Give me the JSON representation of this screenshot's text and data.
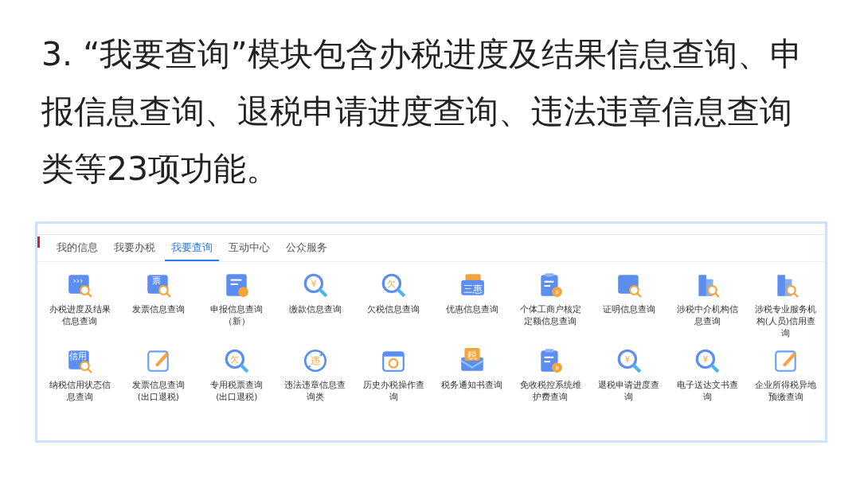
{
  "heading": "3. “我要查询”模块包含办税进度及结果信息查询、申报信息查询、退税申请进度查询、违法违章信息查询类等23项功能。",
  "tabs": [
    {
      "label": "我的信息",
      "selected": false
    },
    {
      "label": "我要办税",
      "selected": false
    },
    {
      "label": "我要查询",
      "selected": true
    },
    {
      "label": "互动中心",
      "selected": false
    },
    {
      "label": "公众服务",
      "selected": false
    }
  ],
  "items": [
    {
      "label": "办税进度及结果信息查询",
      "kind": "card",
      "glyph": "›››"
    },
    {
      "label": "发票信息查询",
      "kind": "card",
      "glyph": "票"
    },
    {
      "label": "申报信息查询（新）",
      "kind": "doc"
    },
    {
      "label": "缴款信息查询",
      "kind": "magnifier",
      "glyph": "¥"
    },
    {
      "label": "欠税信息查询",
      "kind": "magnifier",
      "glyph": "欠"
    },
    {
      "label": "优惠信息查询",
      "kind": "coupon",
      "glyph": "三惠"
    },
    {
      "label": "个体工商户核定定额信息查询",
      "kind": "clipboard",
      "glyph": "¥"
    },
    {
      "label": "证明信息查询",
      "kind": "card"
    },
    {
      "label": "涉税中介机构信息查询",
      "kind": "building"
    },
    {
      "label": "涉税专业服务机构(人员)信用查询",
      "kind": "building"
    },
    {
      "label": "纳税信用状态信息查询",
      "kind": "card",
      "glyph": "信用"
    },
    {
      "label": "发票信息查询(出口退税)",
      "kind": "edit"
    },
    {
      "label": "专用税票查询(出口退税)",
      "kind": "magnifier",
      "glyph": "欠"
    },
    {
      "label": "违法违章信息查询类",
      "kind": "ban",
      "glyph": "违"
    },
    {
      "label": "历史办税操作查询",
      "kind": "calendar"
    },
    {
      "label": "税务通知书查询",
      "kind": "envelope",
      "glyph": "税"
    },
    {
      "label": "免收税控系统维护费查询",
      "kind": "clipboard",
      "glyph": "¥"
    },
    {
      "label": "退税申请进度查询",
      "kind": "magnifier",
      "glyph": "¥"
    },
    {
      "label": "电子送达文书查询",
      "kind": "magnifier",
      "glyph": "¥"
    },
    {
      "label": "企业所得税异地预缴查询",
      "kind": "edit"
    }
  ]
}
